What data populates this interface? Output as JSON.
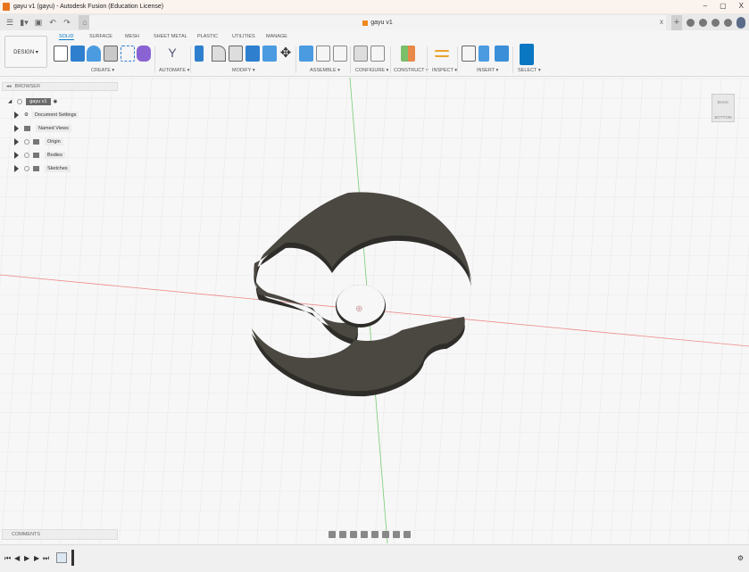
{
  "window": {
    "title": "gayu v1 (gayu) - Autodesk Fusion (Education License)",
    "controls": [
      "–",
      "▢",
      "X"
    ]
  },
  "document_tab": {
    "title": "gayu v1",
    "close": "x"
  },
  "workspace": {
    "label": "DESIGN ▾"
  },
  "ribbon_tabs": [
    "SOLID",
    "SURFACE",
    "MESH",
    "SHEET METAL",
    "PLASTIC",
    "UTILITIES",
    "MANAGE"
  ],
  "active_tab": "SOLID",
  "groups": [
    "CREATE ▾",
    "AUTOMATE ▾",
    "MODIFY ▾",
    "ASSEMBLE ▾",
    "CONFIGURE ▾",
    "CONSTRUCT ▾",
    "INSPECT ▾",
    "INSERT ▾",
    "SELECT ▾"
  ],
  "browser": {
    "title": "BROWSER",
    "root": "gayu v1",
    "items": [
      "Document Settings",
      "Named Views",
      "Origin",
      "Bodies",
      "Sketches"
    ]
  },
  "comments": {
    "title": "COMMENTS"
  },
  "viewcube": {
    "faces": [
      "BACK",
      "BOTTOM"
    ]
  },
  "colors": {
    "accent": "#0a77c2",
    "body_top": "#4b4841",
    "body_side": "#2f2d29",
    "x_axis": "#e06060",
    "y_axis": "#60c060"
  }
}
